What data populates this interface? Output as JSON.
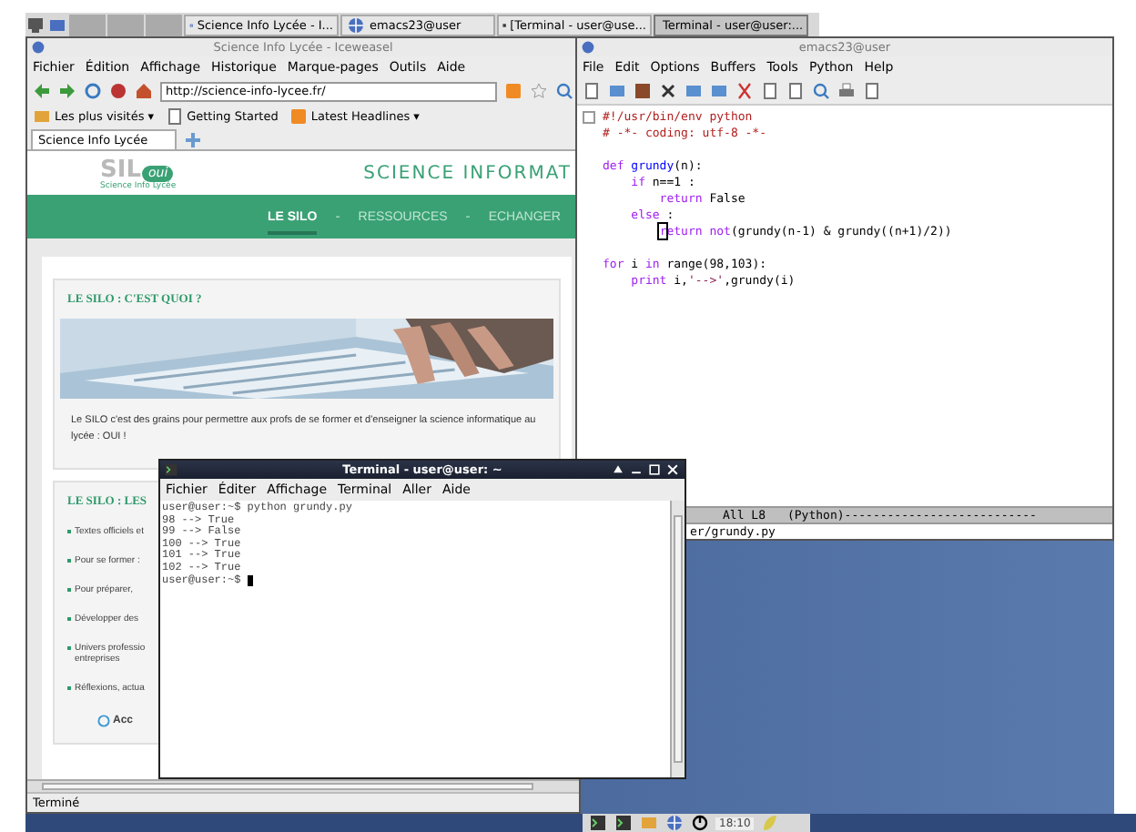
{
  "taskbar": {
    "tasks": [
      {
        "label": "Science Info Lycée - I...",
        "kind": "browser",
        "selected": false
      },
      {
        "label": "emacs23@user",
        "kind": "emacs",
        "selected": false
      },
      {
        "label": "[Terminal - user@use...",
        "kind": "terminal",
        "selected": false
      },
      {
        "label": "Terminal - user@user:...",
        "kind": "terminal",
        "selected": true
      }
    ]
  },
  "browser": {
    "title": "Science Info Lycée - Iceweasel",
    "menu": [
      "Fichier",
      "Édition",
      "Affichage",
      "Historique",
      "Marque-pages",
      "Outils",
      "Aide"
    ],
    "url": "http://science-info-lycee.fr/",
    "bookmarks": [
      "Les plus visités ▾",
      "Getting Started",
      "Latest Headlines ▾"
    ],
    "tabs": [
      {
        "label": "Science Info Lycée",
        "selected": true
      }
    ],
    "page": {
      "logo": "SIL",
      "logo_bubble": "oui",
      "logo_caption": "Science Info Lycée",
      "site_title": "SCIENCE INFORMAT",
      "nav": [
        {
          "label": "LE SILO",
          "selected": true
        },
        {
          "label": "RESSOURCES",
          "selected": false
        },
        {
          "label": "ECHANGER",
          "selected": false
        }
      ],
      "nav_separators": [
        "-",
        "-"
      ],
      "intro_card": {
        "title": "LE SILO : C'EST QUOI ?",
        "text": "Le SILO c'est des grains pour permettre aux profs de se former et d'enseigner la science informatique au lycée : OUI !"
      },
      "list_card": {
        "title": "LE SILO : LES",
        "items": [
          "Textes officiels et",
          "Pour se former :",
          "Pour préparer,",
          "Développer des",
          "Univers professio\nentreprises",
          "Réflexions, actua"
        ],
        "button": "Acc"
      }
    },
    "status": "Terminé"
  },
  "emacs": {
    "title": "emacs23@user",
    "menu": [
      "File",
      "Edit",
      "Options",
      "Buffers",
      "Tools",
      "Python",
      "Help"
    ],
    "code": [
      {
        "tokens": [
          {
            "kind": "comment",
            "text": "#!/usr/bin/env python"
          }
        ]
      },
      {
        "tokens": [
          {
            "kind": "comment",
            "text": "# -*- coding: utf-8 -*-"
          }
        ]
      },
      {
        "blank_before": true,
        "tokens": [
          {
            "kind": "keyword",
            "text": "def "
          },
          {
            "kind": "function",
            "text": "grundy"
          },
          {
            "kind": "plain",
            "text": "(n):"
          }
        ]
      },
      {
        "tokens": [
          {
            "kind": "keyword",
            "text": "    if"
          },
          {
            "kind": "plain",
            "text": " n==1 :"
          }
        ]
      },
      {
        "tokens": [
          {
            "kind": "keyword",
            "text": "        return"
          },
          {
            "kind": "plain",
            "text": " False"
          }
        ]
      },
      {
        "tokens": [
          {
            "kind": "keyword",
            "text": "    else"
          },
          {
            "kind": "plain",
            "text": " :"
          }
        ]
      },
      {
        "tokens": [
          {
            "kind": "keyword",
            "text": "        r",
            "cursor": true
          },
          {
            "kind": "keyword",
            "text": "eturn not"
          },
          {
            "kind": "plain",
            "text": "(grundy(n-1) & grundy((n+1)/2))"
          }
        ]
      },
      {
        "blank_before": true,
        "tokens": [
          {
            "kind": "keyword",
            "text": "for"
          },
          {
            "kind": "plain",
            "text": " i "
          },
          {
            "kind": "keyword",
            "text": "in"
          },
          {
            "kind": "plain",
            "text": " range(98,103):"
          }
        ]
      },
      {
        "tokens": [
          {
            "kind": "keyword",
            "text": "    print"
          },
          {
            "kind": "plain",
            "text": " i,"
          },
          {
            "kind": "string",
            "text": "'-->'"
          },
          {
            "kind": "plain",
            "text": ",grundy(i)"
          }
        ]
      }
    ],
    "modeline": [
      "All L8",
      "(Python)---------------------------"
    ],
    "minibuffer": "er/grundy.py"
  },
  "terminal": {
    "title": "Terminal - user@user: ~",
    "menu": [
      "Fichier",
      "Éditer",
      "Affichage",
      "Terminal",
      "Aller",
      "Aide"
    ],
    "lines": [
      "user@user:~$ python grundy.py",
      "98 --> True",
      "99 --> False",
      "100 --> True",
      "101 --> True",
      "102 --> True",
      "user@user:~$ "
    ]
  },
  "tray": {
    "clock": "18:10"
  }
}
